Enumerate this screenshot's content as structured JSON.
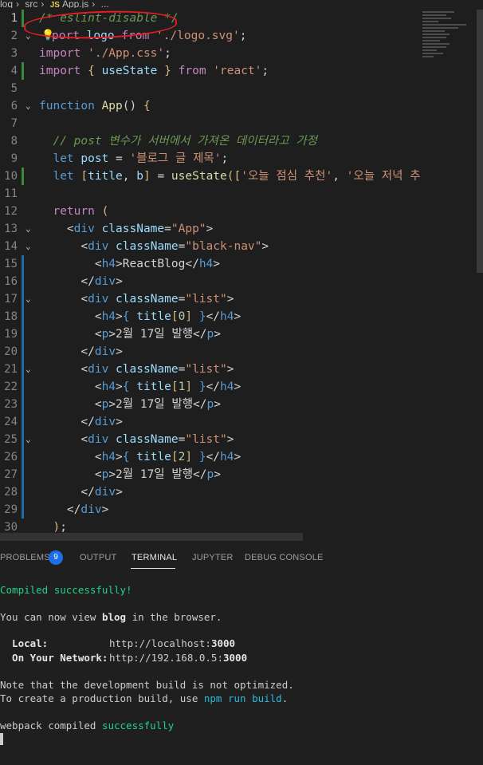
{
  "breadcrumb": {
    "items": [
      "log",
      "src",
      "App.js",
      "..."
    ],
    "js_icon": "JS"
  },
  "editor": {
    "lines": [
      {
        "n": "1",
        "segments": [
          {
            "t": "/* eslint-disable */",
            "c": "cmt"
          }
        ]
      },
      {
        "n": "2",
        "segments": [
          {
            "t": "port ",
            "c": "kw2"
          },
          {
            "t": "logo ",
            "c": "var"
          },
          {
            "t": "from ",
            "c": "kw2"
          },
          {
            "t": "'./logo.svg'",
            "c": "str"
          },
          {
            "t": ";",
            "c": ""
          }
        ]
      },
      {
        "n": "3",
        "segments": [
          {
            "t": "import ",
            "c": "kw2"
          },
          {
            "t": "'./App.css'",
            "c": "str"
          },
          {
            "t": ";",
            "c": ""
          }
        ]
      },
      {
        "n": "4",
        "segments": [
          {
            "t": "import ",
            "c": "kw2"
          },
          {
            "t": "{ ",
            "c": "brk"
          },
          {
            "t": "useState ",
            "c": "var"
          },
          {
            "t": "} ",
            "c": "brk"
          },
          {
            "t": "from ",
            "c": "kw2"
          },
          {
            "t": "'react'",
            "c": "str"
          },
          {
            "t": ";",
            "c": ""
          }
        ]
      },
      {
        "n": "5",
        "segments": []
      },
      {
        "n": "6",
        "segments": [
          {
            "t": "function ",
            "c": "kw"
          },
          {
            "t": "App",
            "c": "fn"
          },
          {
            "t": "() ",
            "c": ""
          },
          {
            "t": "{",
            "c": "brk"
          }
        ]
      },
      {
        "n": "7",
        "segments": []
      },
      {
        "n": "8",
        "segments": [
          {
            "t": "  ",
            "c": "ws"
          },
          {
            "t": "// post 변수가 서버에서 가져온 데이터라고 가정",
            "c": "cmt"
          }
        ]
      },
      {
        "n": "9",
        "segments": [
          {
            "t": "  ",
            "c": "ws"
          },
          {
            "t": "let ",
            "c": "kw"
          },
          {
            "t": "post ",
            "c": "var"
          },
          {
            "t": "= ",
            "c": ""
          },
          {
            "t": "'블로그 글 제목'",
            "c": "str"
          },
          {
            "t": ";",
            "c": ""
          }
        ]
      },
      {
        "n": "10",
        "segments": [
          {
            "t": "  ",
            "c": "ws"
          },
          {
            "t": "let ",
            "c": "kw"
          },
          {
            "t": "[",
            "c": "brk"
          },
          {
            "t": "title",
            "c": "var"
          },
          {
            "t": ", ",
            "c": ""
          },
          {
            "t": "b",
            "c": "var"
          },
          {
            "t": "] ",
            "c": "brk"
          },
          {
            "t": "= ",
            "c": ""
          },
          {
            "t": "useState",
            "c": "fn"
          },
          {
            "t": "([",
            "c": "brk"
          },
          {
            "t": "'오늘 점심 추천'",
            "c": "str"
          },
          {
            "t": ", ",
            "c": ""
          },
          {
            "t": "'오늘 저녁 추",
            "c": "str"
          }
        ]
      },
      {
        "n": "11",
        "segments": []
      },
      {
        "n": "12",
        "segments": [
          {
            "t": "  ",
            "c": "ws"
          },
          {
            "t": "return ",
            "c": "kw2"
          },
          {
            "t": "(",
            "c": "brk"
          }
        ]
      },
      {
        "n": "13",
        "segments": [
          {
            "t": "    ",
            "c": "ws"
          },
          {
            "t": "<",
            "c": ""
          },
          {
            "t": "div ",
            "c": "tag"
          },
          {
            "t": "className",
            "c": "attr"
          },
          {
            "t": "=",
            "c": ""
          },
          {
            "t": "\"App\"",
            "c": "str"
          },
          {
            "t": ">",
            "c": ""
          }
        ]
      },
      {
        "n": "14",
        "segments": [
          {
            "t": "      ",
            "c": "ws"
          },
          {
            "t": "<",
            "c": ""
          },
          {
            "t": "div ",
            "c": "tag"
          },
          {
            "t": "className",
            "c": "attr"
          },
          {
            "t": "=",
            "c": ""
          },
          {
            "t": "\"black-nav\"",
            "c": "str"
          },
          {
            "t": ">",
            "c": ""
          }
        ]
      },
      {
        "n": "15",
        "segments": [
          {
            "t": "        ",
            "c": "ws"
          },
          {
            "t": "<",
            "c": ""
          },
          {
            "t": "h4",
            "c": "tag"
          },
          {
            "t": ">ReactBlog</",
            "c": ""
          },
          {
            "t": "h4",
            "c": "tag"
          },
          {
            "t": ">",
            "c": ""
          }
        ]
      },
      {
        "n": "16",
        "segments": [
          {
            "t": "      ",
            "c": "ws"
          },
          {
            "t": "</",
            "c": ""
          },
          {
            "t": "div",
            "c": "tag"
          },
          {
            "t": ">",
            "c": ""
          }
        ]
      },
      {
        "n": "17",
        "segments": [
          {
            "t": "      ",
            "c": "ws"
          },
          {
            "t": "<",
            "c": ""
          },
          {
            "t": "div ",
            "c": "tag"
          },
          {
            "t": "className",
            "c": "attr"
          },
          {
            "t": "=",
            "c": ""
          },
          {
            "t": "\"list\"",
            "c": "str"
          },
          {
            "t": ">",
            "c": ""
          }
        ]
      },
      {
        "n": "18",
        "segments": [
          {
            "t": "        ",
            "c": "ws"
          },
          {
            "t": "<",
            "c": ""
          },
          {
            "t": "h4",
            "c": "tag"
          },
          {
            "t": ">",
            "c": ""
          },
          {
            "t": "{ ",
            "c": "kw"
          },
          {
            "t": "title",
            "c": "var"
          },
          {
            "t": "[",
            "c": "brk"
          },
          {
            "t": "0",
            "c": "num"
          },
          {
            "t": "] ",
            "c": "brk"
          },
          {
            "t": "}",
            "c": "kw"
          },
          {
            "t": "</",
            "c": ""
          },
          {
            "t": "h4",
            "c": "tag"
          },
          {
            "t": ">",
            "c": ""
          }
        ]
      },
      {
        "n": "19",
        "segments": [
          {
            "t": "        ",
            "c": "ws"
          },
          {
            "t": "<",
            "c": ""
          },
          {
            "t": "p",
            "c": "tag"
          },
          {
            "t": ">2월 17일 발행</",
            "c": ""
          },
          {
            "t": "p",
            "c": "tag"
          },
          {
            "t": ">",
            "c": ""
          }
        ]
      },
      {
        "n": "20",
        "segments": [
          {
            "t": "      ",
            "c": "ws"
          },
          {
            "t": "</",
            "c": ""
          },
          {
            "t": "div",
            "c": "tag"
          },
          {
            "t": ">",
            "c": ""
          }
        ]
      },
      {
        "n": "21",
        "segments": [
          {
            "t": "      ",
            "c": "ws"
          },
          {
            "t": "<",
            "c": ""
          },
          {
            "t": "div ",
            "c": "tag"
          },
          {
            "t": "className",
            "c": "attr"
          },
          {
            "t": "=",
            "c": ""
          },
          {
            "t": "\"list\"",
            "c": "str"
          },
          {
            "t": ">",
            "c": ""
          }
        ]
      },
      {
        "n": "22",
        "segments": [
          {
            "t": "        ",
            "c": "ws"
          },
          {
            "t": "<",
            "c": ""
          },
          {
            "t": "h4",
            "c": "tag"
          },
          {
            "t": ">",
            "c": ""
          },
          {
            "t": "{ ",
            "c": "kw"
          },
          {
            "t": "title",
            "c": "var"
          },
          {
            "t": "[",
            "c": "brk"
          },
          {
            "t": "1",
            "c": "num"
          },
          {
            "t": "] ",
            "c": "brk"
          },
          {
            "t": "}",
            "c": "kw"
          },
          {
            "t": "</",
            "c": ""
          },
          {
            "t": "h4",
            "c": "tag"
          },
          {
            "t": ">",
            "c": ""
          }
        ]
      },
      {
        "n": "23",
        "segments": [
          {
            "t": "        ",
            "c": "ws"
          },
          {
            "t": "<",
            "c": ""
          },
          {
            "t": "p",
            "c": "tag"
          },
          {
            "t": ">2월 17일 발행</",
            "c": ""
          },
          {
            "t": "p",
            "c": "tag"
          },
          {
            "t": ">",
            "c": ""
          }
        ]
      },
      {
        "n": "24",
        "segments": [
          {
            "t": "      ",
            "c": "ws"
          },
          {
            "t": "</",
            "c": ""
          },
          {
            "t": "div",
            "c": "tag"
          },
          {
            "t": ">",
            "c": ""
          }
        ]
      },
      {
        "n": "25",
        "segments": [
          {
            "t": "      ",
            "c": "ws"
          },
          {
            "t": "<",
            "c": ""
          },
          {
            "t": "div ",
            "c": "tag"
          },
          {
            "t": "className",
            "c": "attr"
          },
          {
            "t": "=",
            "c": ""
          },
          {
            "t": "\"list\"",
            "c": "str"
          },
          {
            "t": ">",
            "c": ""
          }
        ]
      },
      {
        "n": "26",
        "segments": [
          {
            "t": "        ",
            "c": "ws"
          },
          {
            "t": "<",
            "c": ""
          },
          {
            "t": "h4",
            "c": "tag"
          },
          {
            "t": ">",
            "c": ""
          },
          {
            "t": "{ ",
            "c": "kw"
          },
          {
            "t": "title",
            "c": "var"
          },
          {
            "t": "[",
            "c": "brk"
          },
          {
            "t": "2",
            "c": "num"
          },
          {
            "t": "] ",
            "c": "brk"
          },
          {
            "t": "}",
            "c": "kw"
          },
          {
            "t": "</",
            "c": ""
          },
          {
            "t": "h4",
            "c": "tag"
          },
          {
            "t": ">",
            "c": ""
          }
        ]
      },
      {
        "n": "27",
        "segments": [
          {
            "t": "        ",
            "c": "ws"
          },
          {
            "t": "<",
            "c": ""
          },
          {
            "t": "p",
            "c": "tag"
          },
          {
            "t": ">2월 17일 발행</",
            "c": ""
          },
          {
            "t": "p",
            "c": "tag"
          },
          {
            "t": ">",
            "c": ""
          }
        ]
      },
      {
        "n": "28",
        "segments": [
          {
            "t": "      ",
            "c": "ws"
          },
          {
            "t": "</",
            "c": ""
          },
          {
            "t": "div",
            "c": "tag"
          },
          {
            "t": ">",
            "c": ""
          }
        ]
      },
      {
        "n": "29",
        "segments": [
          {
            "t": "    ",
            "c": "ws"
          },
          {
            "t": "</",
            "c": ""
          },
          {
            "t": "div",
            "c": "tag"
          },
          {
            "t": ">",
            "c": ""
          }
        ]
      },
      {
        "n": "30",
        "segments": [
          {
            "t": "  ",
            "c": "ws"
          },
          {
            "t": ")",
            "c": "brk"
          },
          {
            "t": ";",
            "c": ""
          }
        ]
      }
    ],
    "warning_icon": "lightbulb-icon"
  },
  "panel": {
    "tabs": [
      {
        "label": "PROBLEMS",
        "active": false
      },
      {
        "label": "OUTPUT",
        "active": false
      },
      {
        "label": "TERMINAL",
        "active": true
      },
      {
        "label": "JUPYTER",
        "active": false
      },
      {
        "label": "DEBUG CONSOLE",
        "active": false
      }
    ],
    "problems_count": "9"
  },
  "terminal": {
    "compiled": "Compiled successfully!",
    "view_prefix": "You can now view ",
    "app_name": "blog",
    "view_suffix": " in the browser.",
    "local_label": "  Local:",
    "local_url_prefix": "http://localhost:",
    "local_port": "3000",
    "network_label": "  On Your Network:",
    "network_url_prefix": "http://192.168.0.5:",
    "network_port": "3000",
    "note1": "Note that the development build is not optimized.",
    "note2_prefix": "To create a production build, use ",
    "note2_cmd": "npm run build",
    "note2_suffix": ".",
    "webpack_prefix": "webpack compiled ",
    "webpack_status": "successfully"
  },
  "colors": {
    "editor_bg": "#1e1e1e",
    "panel_bg": "#1f1f1f",
    "annotation_circle": "#e21f24",
    "badge": "#1c6ee8",
    "success": "#23d18b"
  }
}
